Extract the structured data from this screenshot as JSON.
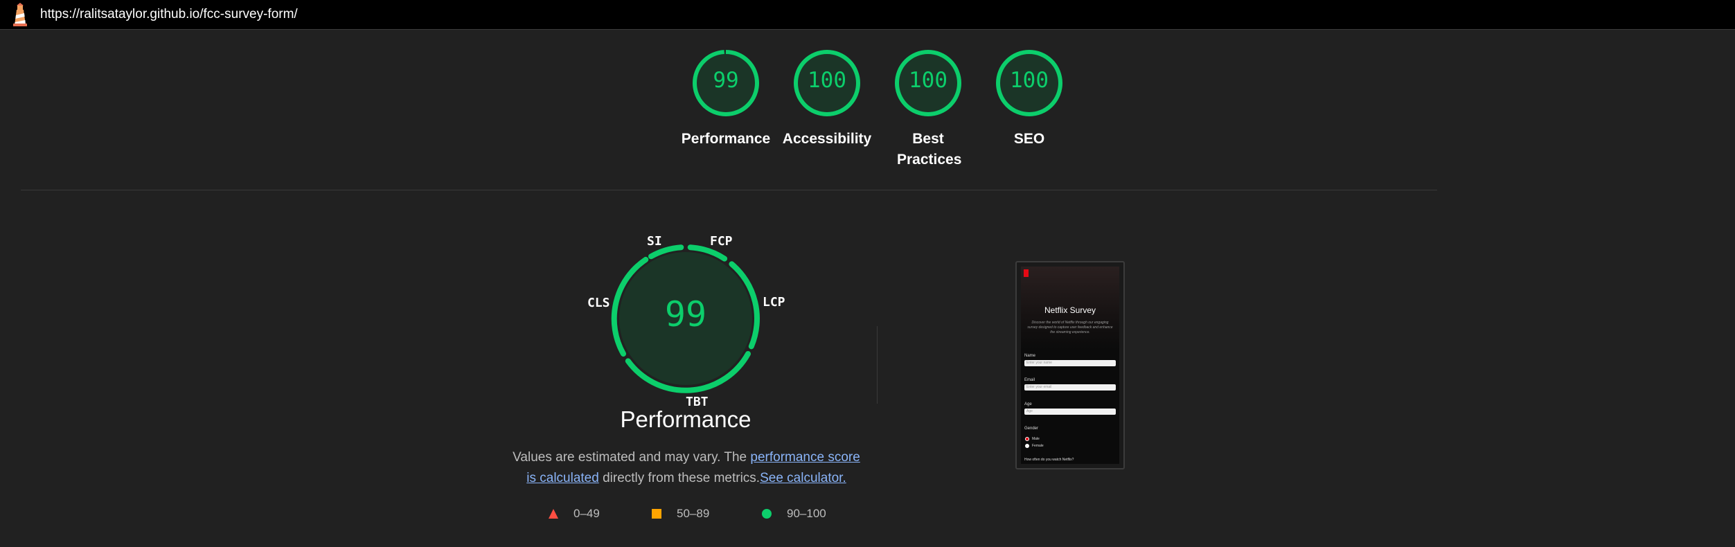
{
  "browser": {
    "url": "https://ralitsataylor.github.io/fcc-survey-form/",
    "logo_icon": "lighthouse-icon"
  },
  "gauges": [
    {
      "label": "Performance",
      "score": "99",
      "fraction": 0.99
    },
    {
      "label": "Accessibility",
      "score": "100",
      "fraction": 1.0
    },
    {
      "label": "Best Practices",
      "score": "100",
      "fraction": 1.0
    },
    {
      "label": "SEO",
      "score": "100",
      "fraction": 1.0
    }
  ],
  "performance": {
    "score": "99",
    "title": "Performance",
    "metrics": {
      "si": "SI",
      "fcp": "FCP",
      "lcp": "LCP",
      "tbt": "TBT",
      "cls": "CLS"
    },
    "desc_prefix": "Values are estimated and may vary. The ",
    "desc_link1": "performance score is calculated",
    "desc_middle": " directly from these metrics.",
    "desc_link2": "See calculator.",
    "legend": [
      {
        "label": "0–49",
        "shape": "triangle",
        "color": "#ff4e42"
      },
      {
        "label": "50–89",
        "shape": "square",
        "color": "#ffa400"
      },
      {
        "label": "90–100",
        "shape": "circle",
        "color": "#0cce6b"
      }
    ]
  },
  "screenshot": {
    "title": "Netflix Survey",
    "description": "Discover the world of Netflix through our engaging survey designed to capture user feedback and enhance the streaming experience.",
    "fields": [
      {
        "label": "Name",
        "placeholder": "Enter your name"
      },
      {
        "label": "Email",
        "placeholder": "Enter your email"
      },
      {
        "label": "Age",
        "placeholder": "Age"
      }
    ],
    "gender_label": "Gender",
    "gender_options": [
      "Male",
      "Female"
    ],
    "next_question": "How often do you watch Netflix?"
  },
  "colors": {
    "pass": "#0cce6b",
    "pass_bg": "#1b3527",
    "link": "#8ab4f8"
  }
}
